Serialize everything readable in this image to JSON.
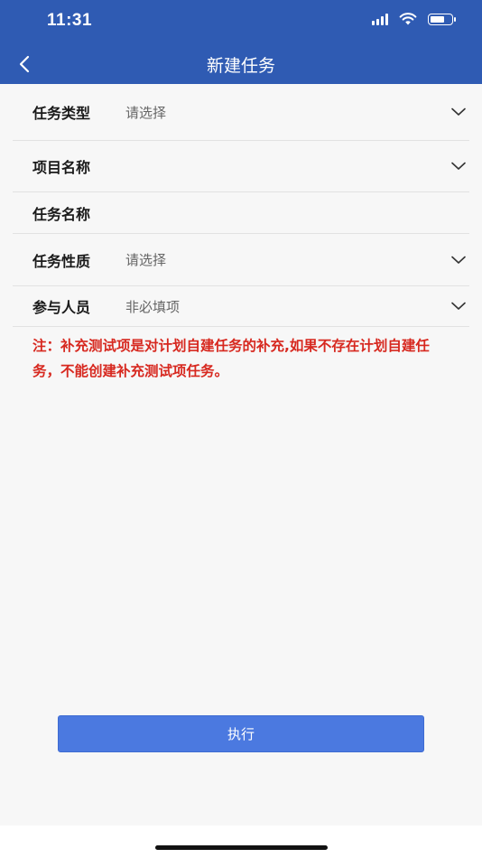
{
  "status_bar": {
    "time": "11:31"
  },
  "nav": {
    "title": "新建任务",
    "back_icon": "chevron-left-icon"
  },
  "form": {
    "fields": [
      {
        "label": "任务类型",
        "value": "请选择"
      },
      {
        "label": "项目名称",
        "value": ""
      },
      {
        "label": "任务名称",
        "value": ""
      },
      {
        "label": "任务性质",
        "value": "请选择"
      },
      {
        "label": "参与人员",
        "value": "非必填项"
      }
    ]
  },
  "note": "注：补充测试项是对计划自建任务的补充,如果不存在计划自建任务，不能创建补充测试项任务。",
  "actions": {
    "execute_label": "执行"
  },
  "colors": {
    "header": "#2f5bb3",
    "note": "#d7281f",
    "button": "#4b79e0"
  }
}
